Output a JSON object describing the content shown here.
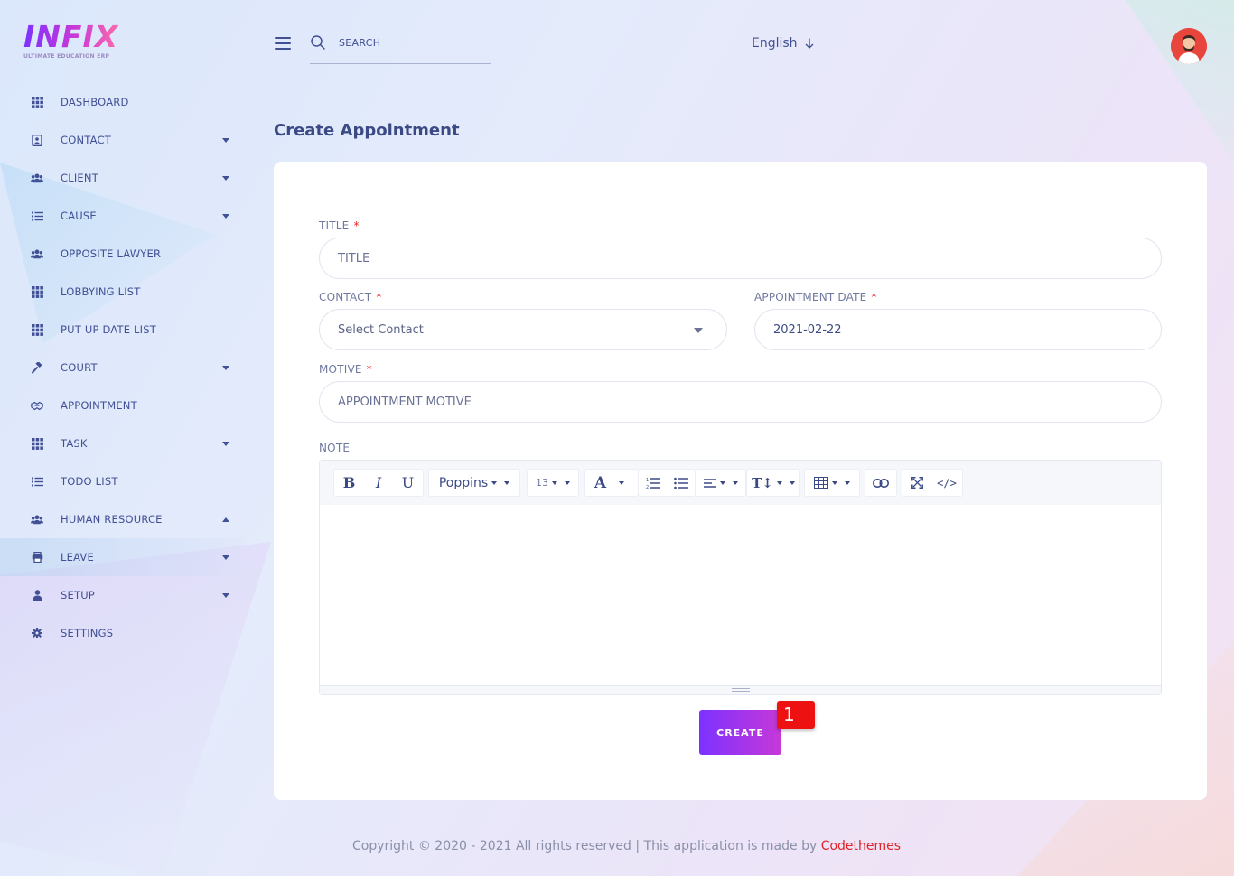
{
  "brand": {
    "logo_text": "INFIX",
    "logo_subtitle": "ULTIMATE EDUCATION ERP"
  },
  "sidebar": {
    "items": [
      {
        "label": "DASHBOARD",
        "icon": "grid-icon",
        "caret": "none"
      },
      {
        "label": "CONTACT",
        "icon": "contact-book-icon",
        "caret": "down"
      },
      {
        "label": "CLIENT",
        "icon": "users-icon",
        "caret": "down"
      },
      {
        "label": "CAUSE",
        "icon": "list-icon",
        "caret": "down"
      },
      {
        "label": "OPPOSITE LAWYER",
        "icon": "users-icon",
        "caret": "none"
      },
      {
        "label": "LOBBYING LIST",
        "icon": "grid-icon",
        "caret": "none"
      },
      {
        "label": "PUT UP DATE LIST",
        "icon": "grid-icon",
        "caret": "none"
      },
      {
        "label": "COURT",
        "icon": "gavel-icon",
        "caret": "down"
      },
      {
        "label": "APPOINTMENT",
        "icon": "handshake-icon",
        "caret": "none"
      },
      {
        "label": "TASK",
        "icon": "grid-icon",
        "caret": "down"
      },
      {
        "label": "TODO LIST",
        "icon": "list-icon",
        "caret": "none"
      },
      {
        "label": "HUMAN RESOURCE",
        "icon": "users-icon",
        "caret": "up"
      },
      {
        "label": "LEAVE",
        "icon": "printer-icon",
        "caret": "down"
      },
      {
        "label": "SETUP",
        "icon": "user-icon",
        "caret": "down"
      },
      {
        "label": "SETTINGS",
        "icon": "gear-icon",
        "caret": "none"
      }
    ]
  },
  "header": {
    "search_placeholder": "SEARCH",
    "language": "English"
  },
  "page": {
    "title": "Create Appointment"
  },
  "form": {
    "title_label": "TITLE",
    "title_placeholder": "TITLE",
    "contact_label": "CONTACT",
    "contact_value": "Select Contact",
    "date_label": "APPOINTMENT DATE",
    "date_value": "2021-02-22",
    "motive_label": "MOTIVE",
    "motive_placeholder": "APPOINTMENT MOTIVE",
    "note_label": "NOTE",
    "required_mark": "*",
    "editor": {
      "font_family": "Poppins",
      "font_size": "13"
    },
    "create_label": "CREATE",
    "badge_number": "1"
  },
  "footer": {
    "text": "Copyright © 2020 - 2021 All rights reserved | This application is made by ",
    "link": "Codethemes"
  },
  "colors": {
    "accent_start": "#7c32ff",
    "accent_end": "#c738d8",
    "text_primary": "#415094",
    "required": "#e0222a",
    "badge": "#ee1111"
  }
}
